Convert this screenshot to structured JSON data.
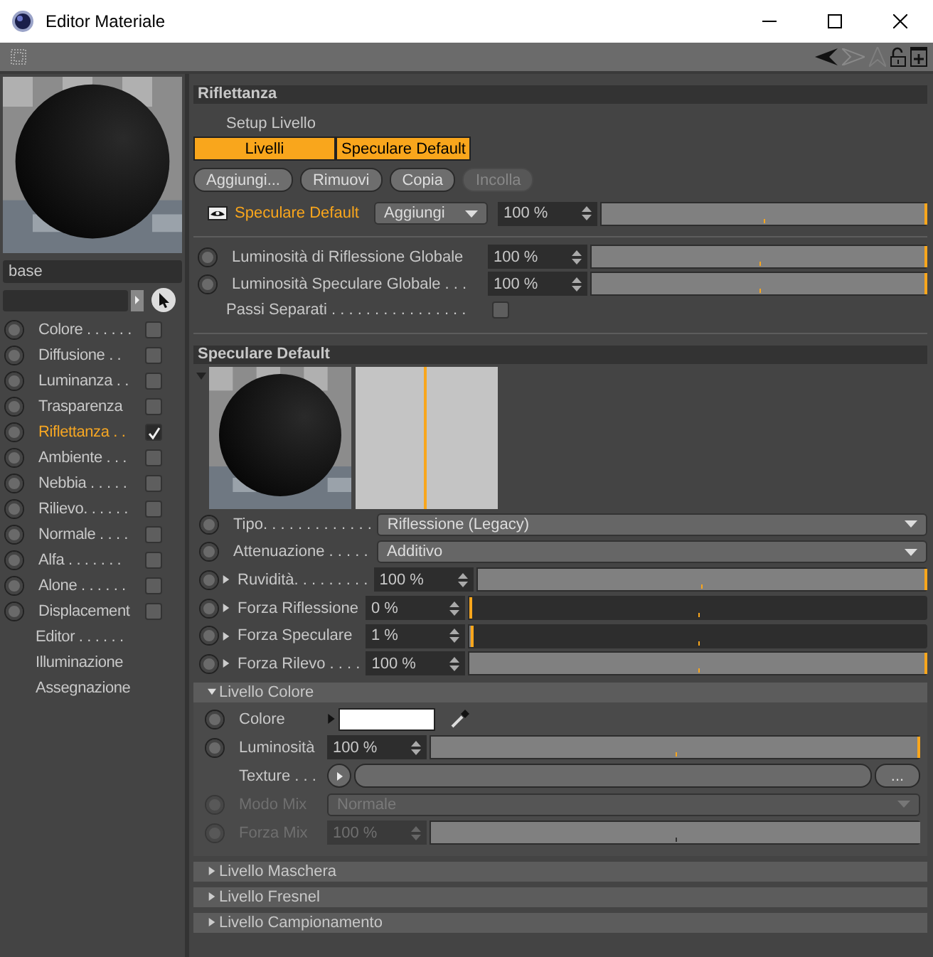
{
  "window": {
    "title": "Editor Materiale"
  },
  "sidebar": {
    "name_field": {
      "value": "base"
    },
    "channels": [
      {
        "kind": "channel",
        "label": "Colore . . . . . .",
        "checked": false,
        "selected": false
      },
      {
        "kind": "channel",
        "label": "Diffusione . .",
        "checked": false,
        "selected": false
      },
      {
        "kind": "channel",
        "label": "Luminanza . .",
        "checked": false,
        "selected": false
      },
      {
        "kind": "channel",
        "label": "Trasparenza",
        "checked": false,
        "selected": false
      },
      {
        "kind": "channel",
        "label": "Riflettanza . .",
        "checked": true,
        "selected": true
      },
      {
        "kind": "channel",
        "label": "Ambiente . . .",
        "checked": false,
        "selected": false
      },
      {
        "kind": "channel",
        "label": "Nebbia . . . . .",
        "checked": false,
        "selected": false
      },
      {
        "kind": "channel",
        "label": "Rilievo. . . . . .",
        "checked": false,
        "selected": false
      },
      {
        "kind": "channel",
        "label": "Normale . . . .",
        "checked": false,
        "selected": false
      },
      {
        "kind": "channel",
        "label": "Alfa . . . . . . .",
        "checked": false,
        "selected": false
      },
      {
        "kind": "channel",
        "label": "Alone . . . . . .",
        "checked": false,
        "selected": false
      },
      {
        "kind": "channel",
        "label": "Displacement",
        "checked": false,
        "selected": false
      },
      {
        "kind": "link",
        "label": "Editor . . . . . .",
        "selected": false
      },
      {
        "kind": "link",
        "label": "Illuminazione",
        "selected": false
      },
      {
        "kind": "link",
        "label": "Assegnazione",
        "selected": false
      }
    ]
  },
  "reflectance": {
    "title": "Riflettanza",
    "setup_label": "Setup Livello",
    "tabs": [
      {
        "label": "Livelli",
        "selected": true
      },
      {
        "label": "Speculare Default",
        "selected": true
      }
    ],
    "buttons": [
      {
        "label": "Aggiungi...",
        "disabled": false
      },
      {
        "label": "Rimuovi",
        "disabled": false
      },
      {
        "label": "Copia",
        "disabled": false
      },
      {
        "label": "Incolla",
        "disabled": true
      }
    ],
    "layer": {
      "visible": true,
      "name": "Speculare Default",
      "mode": "Aggiungi",
      "value": "100 %",
      "level": 1
    },
    "globals": [
      {
        "label": "Luminosità di Riflessione Globale",
        "value": "100 %",
        "level": 1
      },
      {
        "label": "Luminosità Speculare Globale . . .",
        "value": "100 %",
        "level": 1
      }
    ],
    "separate_passes": {
      "label": "Passi Separati . . . . . . . . . . . . . . . .",
      "checked": false
    }
  },
  "layer_panel": {
    "title": "Speculare Default",
    "params": [
      {
        "kind": "dropdown",
        "label": "Tipo. . . . . . . . . . . . .",
        "value": "Riflessione (Legacy)"
      },
      {
        "kind": "dropdown",
        "label": "Attenuazione . . . . .",
        "value": "Additivo"
      },
      {
        "kind": "slider",
        "label": "Ruvidità. . . . . . . . .",
        "value": "100 %",
        "level": 1
      },
      {
        "kind": "slider",
        "label": "Forza Riflessione",
        "value": "0 %",
        "level": 0
      },
      {
        "kind": "slider",
        "label": "Forza Speculare",
        "value": "1 %",
        "level": 0.01
      },
      {
        "kind": "slider",
        "label": "Forza Rilevo . . . .",
        "value": "100 %",
        "level": 1
      }
    ]
  },
  "color_layer": {
    "title": "Livello Colore",
    "expanded": true,
    "params": [
      {
        "kind": "color",
        "label": "Colore",
        "color": "#ffffff"
      },
      {
        "kind": "slider",
        "label": "Luminosità",
        "value": "100 %",
        "level": 1,
        "disabled": false
      },
      {
        "kind": "texture",
        "label": "Texture . . .",
        "button": "..."
      },
      {
        "kind": "dropdown",
        "label": "Modo Mix",
        "value": "Normale",
        "disabled": true
      },
      {
        "kind": "slider",
        "label": "Forza Mix",
        "value": "100 %",
        "level": 1,
        "disabled": true
      }
    ]
  },
  "collapsed_layers": [
    {
      "title": "Livello Maschera",
      "expanded": false
    },
    {
      "title": "Livello Fresnel",
      "expanded": false
    },
    {
      "title": "Livello Campionamento",
      "expanded": false
    }
  ]
}
